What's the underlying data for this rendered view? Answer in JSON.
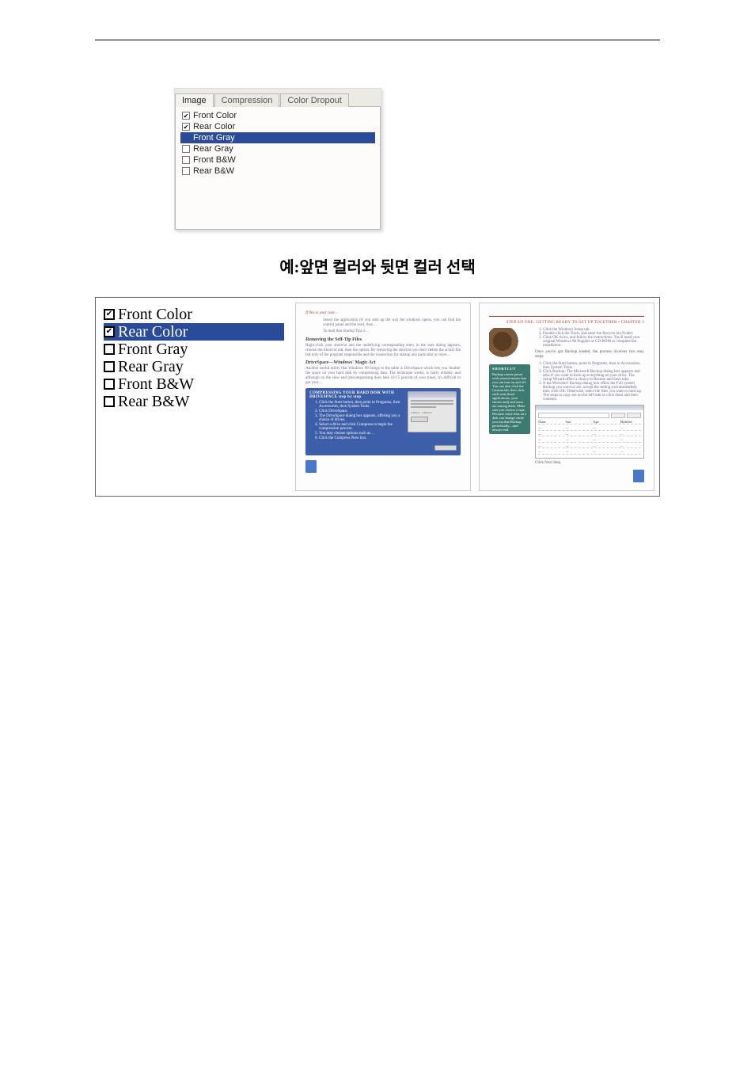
{
  "tabs": {
    "image": "Image",
    "compression": "Compression",
    "color_dropout": "Color Dropout"
  },
  "options": {
    "front_color": "Front Color",
    "rear_color": "Rear Color",
    "front_gray": "Front Gray",
    "rear_gray": "Rear Gray",
    "front_bw": "Front B&W",
    "rear_bw": "Rear B&W"
  },
  "caption": "예:앞면 컬러와 뒷면 컬러 선택",
  "preview": {
    "left": {
      "title_small": "If this is your case…",
      "heading1": "Removing the Self-Tip Files",
      "para1": "Select the application (if you start up the way the windows opens, you can find the control panel and the rest), then…",
      "para2": "To mail that Startup Tips 2…",
      "para3": "Right-click your shortcut and the underlying corresponding entry in the user dialog appears, choose the Shortcut tab, then the option. By removing the shortcut you don't delete the actual file but only of the program responsible and the connection for startup any particular or more…",
      "heading2": "DriveSpace—Windows' Magic Act",
      "para4": "Another useful utility that Windows 98 brings to the table is DriveSpace which lets you 'double' the space on your hard disk by compressing data. The technique works, is fairly reliable, and although on the slow end (decompressing does take 10-15 percent of your time), it's difficult to get your…",
      "bluebox_title": "COMPRESSING YOUR HARD DISK WITH DRIVESPACE step by step",
      "bluebox_items": [
        "Click the Start button, then point to Programs, then Accessories, then System Tools.",
        "Click DriveSpace.",
        "The DriveSpace dialog box appears, offering you a choice of drives.",
        "Select a drive and click Compress to begin the compression process.",
        "You may choose options such as…",
        "Click the Compress Now box."
      ]
    },
    "right": {
      "chapter": "STEP-UP ONE: GETTING READY TO SET UP TOGETHER • CHAPTER 3",
      "list1": [
        "Click the Windows Setup tab.",
        "Double-click the Tools, and enter the Recycle bin Folder.",
        "Click OK twice, and follow the instructions. You'll need your original Windows 98 floppies or CD-ROM to complete the installation."
      ],
      "note": "Once you've got Backup loaded, the process involves two easy steps:",
      "list2": [
        "Click the Start button, point to Programs, then to Accessories, then System Tools.",
        "Click Backup. The Microsoft Backup dialog box appears and asks if you want to back up everything on your drive. The Setup Wizard offers a choice to Restore and Save tabs.",
        "If the Welcome! Backup dialog box offers the Full system Backup you want to use, accept the setting (recommended), then click OK. Otherwise, select the files you want to back up. The steps to copy are on the left side so click them and their contents."
      ],
      "caption2": "Click Next Step.",
      "shortcut_title": "SHORTCUT",
      "shortcut_text": "Backup comes preset with several entries that you can turn on and off. You can also click the Custom tab, then click each item (load applications, your entries and) and users are among them. Make sure you choose a tape. Because some files on a disk can change while you run that Backup periodically—and always end."
    }
  }
}
